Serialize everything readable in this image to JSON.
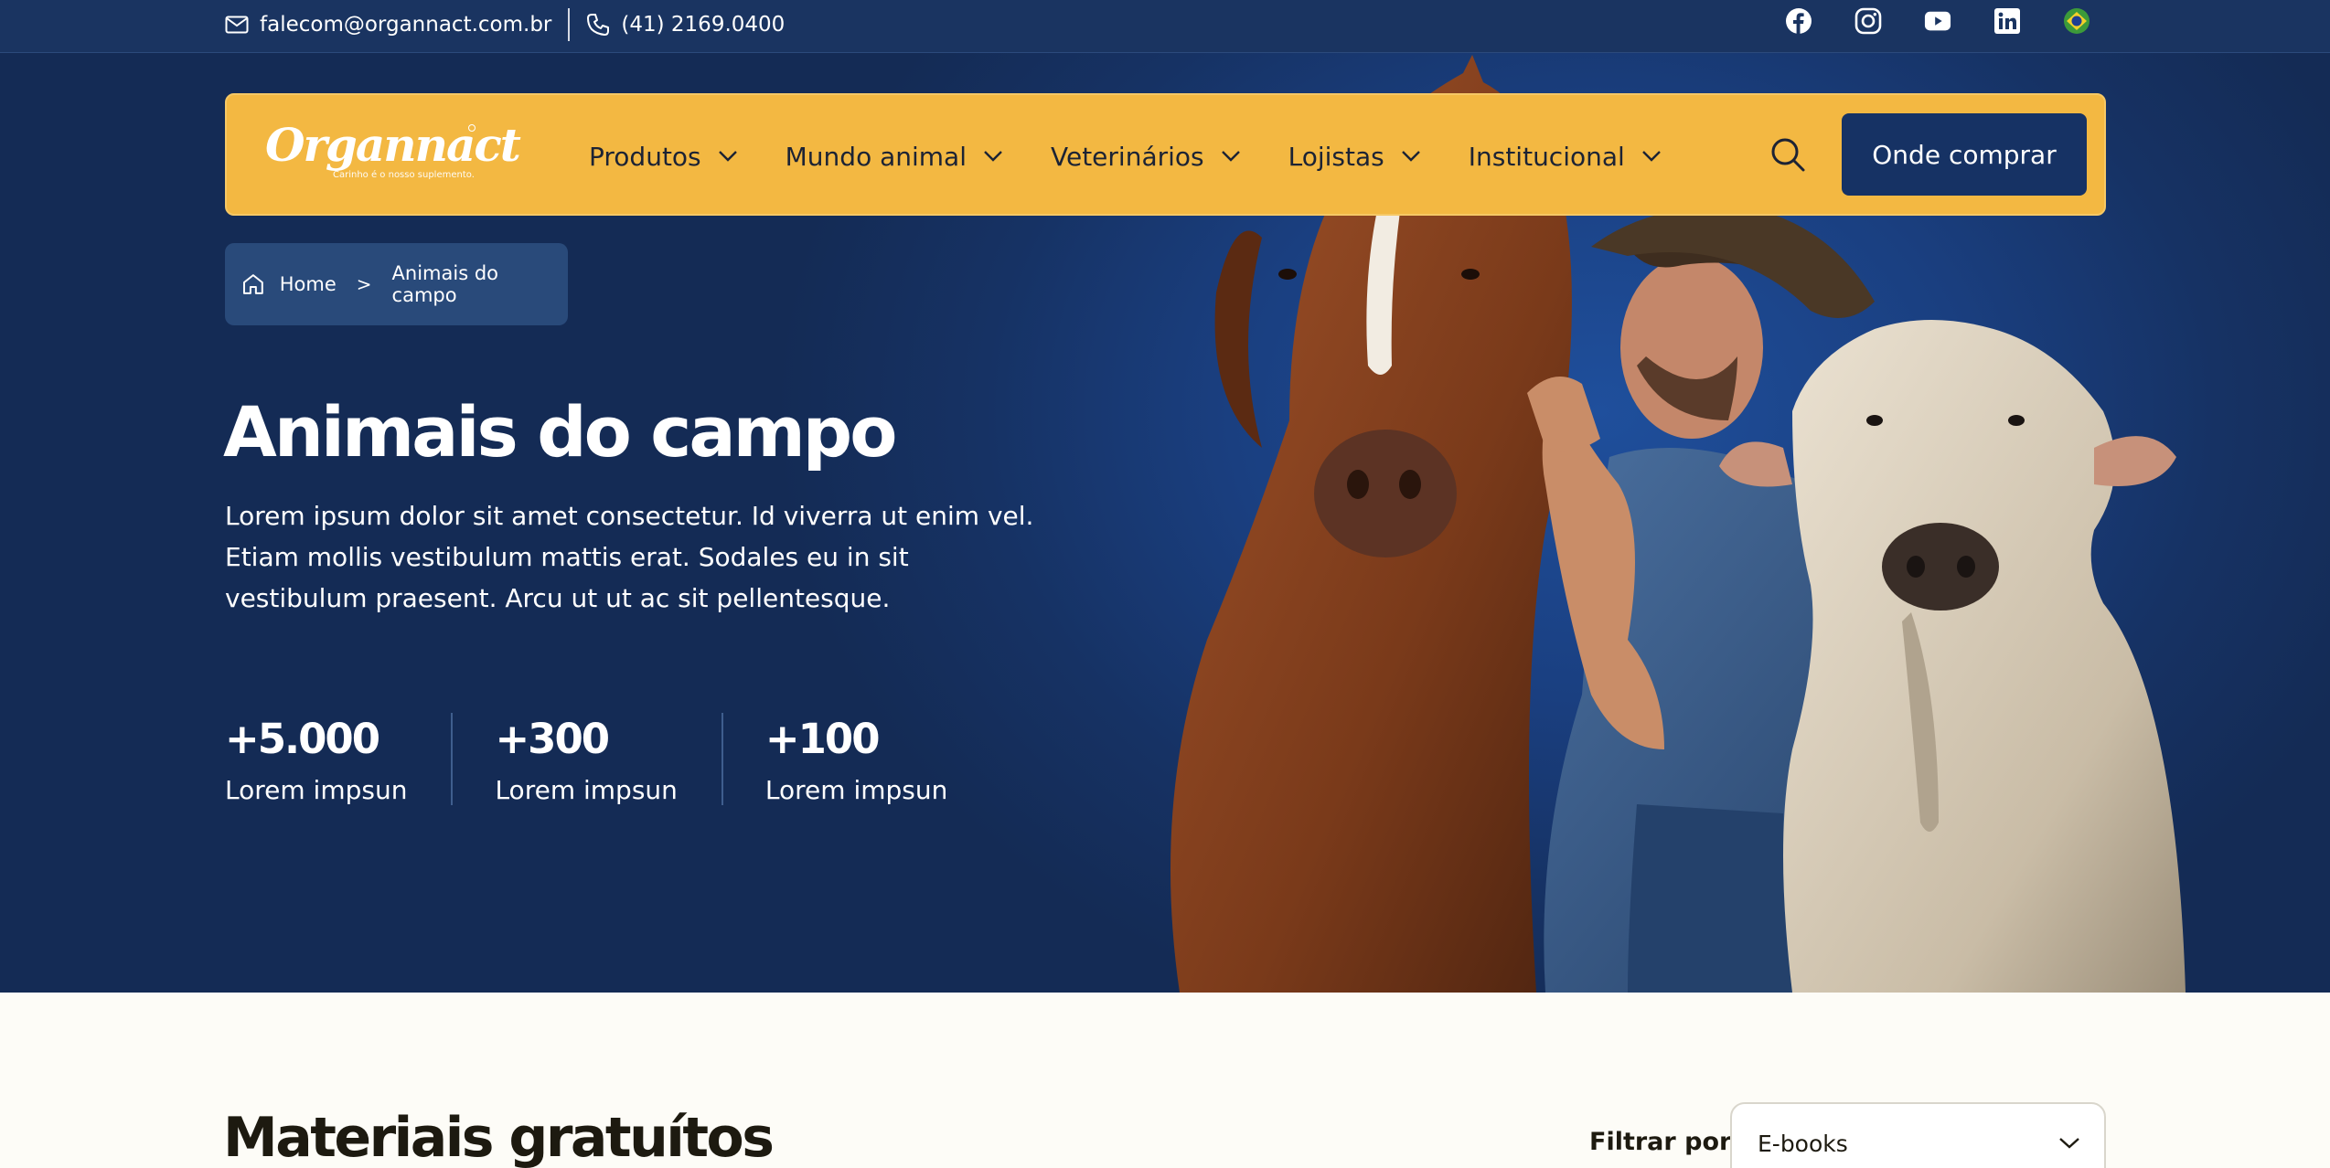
{
  "topbar": {
    "email": "falecom@organnact.com.br",
    "phone": "(41) 2169.0400",
    "socials": [
      "facebook-icon",
      "instagram-icon",
      "youtube-icon",
      "linkedin-icon",
      "brazil-flag-icon"
    ]
  },
  "navbar": {
    "logo_text": "Organnact",
    "logo_tagline": "Carinho é o nosso suplemento.",
    "menu": [
      {
        "label": "Produtos"
      },
      {
        "label": "Mundo animal"
      },
      {
        "label": "Veterinários"
      },
      {
        "label": "Lojistas"
      },
      {
        "label": "Institucional"
      }
    ],
    "cta_label": "Onde comprar"
  },
  "breadcrumb": {
    "home": "Home",
    "separator": ">",
    "current": "Animais do campo"
  },
  "hero": {
    "title": "Animais do campo",
    "description": "Lorem ipsum dolor sit amet consectetur. Id viverra ut enim vel. Etiam mollis vestibulum mattis erat. Sodales eu in sit vestibulum praesent. Arcu ut ut ac sit pellentesque.",
    "stats": [
      {
        "value": "+5.000",
        "label": "Lorem impsun"
      },
      {
        "value": "+300",
        "label": "Lorem impsun"
      },
      {
        "value": "+100",
        "label": "Lorem impsun"
      }
    ]
  },
  "materials": {
    "title": "Materiais gratuítos",
    "filter_label": "Filtrar por:",
    "filter_value": "E-books"
  },
  "colors": {
    "navy": "#163264",
    "topbar": "#1a3461",
    "accent_yellow": "#f3b842",
    "page_bg": "#fdfcf7"
  }
}
